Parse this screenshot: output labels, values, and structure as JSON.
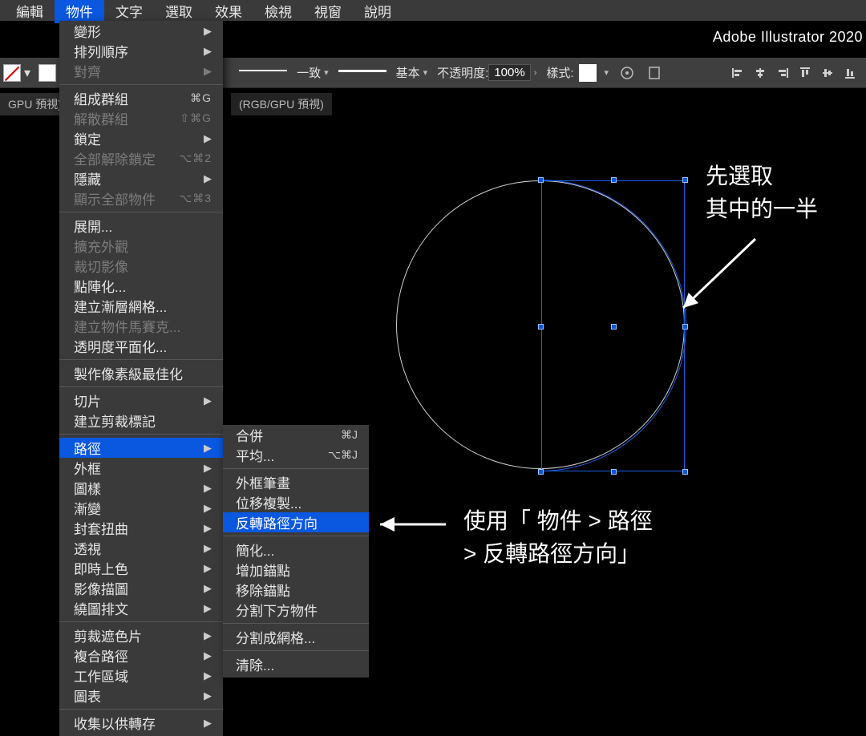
{
  "app_title": "Adobe Illustrator 2020",
  "menubar": [
    "編輯",
    "物件",
    "文字",
    "選取",
    "效果",
    "檢視",
    "視窗",
    "說明"
  ],
  "menubar_active_index": 1,
  "doc_tabs": {
    "left": "GPU 預視)",
    "other": "(RGB/GPU 預視)"
  },
  "ctrlbar": {
    "stroke_mode": "一致",
    "brush_label": "基本",
    "opacity_label": "不透明度:",
    "opacity_value": "100%",
    "style_label": "樣式:"
  },
  "menu": [
    {
      "label": "變形",
      "arrow": true
    },
    {
      "label": "排列順序",
      "arrow": true
    },
    {
      "label": "對齊",
      "arrow": true,
      "dim": true
    },
    {
      "sep": true
    },
    {
      "label": "組成群組",
      "sc": "⌘G"
    },
    {
      "label": "解散群組",
      "sc": "⇧⌘G",
      "dim": true
    },
    {
      "label": "鎖定",
      "arrow": true
    },
    {
      "label": "全部解除鎖定",
      "sc": "⌥⌘2",
      "dim": true
    },
    {
      "label": "隱藏",
      "arrow": true
    },
    {
      "label": "顯示全部物件",
      "sc": "⌥⌘3",
      "dim": true
    },
    {
      "sep": true
    },
    {
      "label": "展開..."
    },
    {
      "label": "擴充外觀",
      "dim": true
    },
    {
      "label": "裁切影像",
      "dim": true
    },
    {
      "label": "點陣化..."
    },
    {
      "label": "建立漸層網格..."
    },
    {
      "label": "建立物件馬賽克...",
      "dim": true
    },
    {
      "label": "透明度平面化..."
    },
    {
      "sep": true
    },
    {
      "label": "製作像素級最佳化"
    },
    {
      "sep": true
    },
    {
      "label": "切片",
      "arrow": true
    },
    {
      "label": "建立剪裁標記"
    },
    {
      "sep": true
    },
    {
      "label": "路徑",
      "arrow": true,
      "sel": true
    },
    {
      "label": "外框",
      "arrow": true
    },
    {
      "label": "圖樣",
      "arrow": true
    },
    {
      "label": "漸變",
      "arrow": true
    },
    {
      "label": "封套扭曲",
      "arrow": true
    },
    {
      "label": "透視",
      "arrow": true
    },
    {
      "label": "即時上色",
      "arrow": true
    },
    {
      "label": "影像描圖",
      "arrow": true
    },
    {
      "label": "繞圖排文",
      "arrow": true
    },
    {
      "sep": true
    },
    {
      "label": "剪裁遮色片",
      "arrow": true
    },
    {
      "label": "複合路徑",
      "arrow": true
    },
    {
      "label": "工作區域",
      "arrow": true
    },
    {
      "label": "圖表",
      "arrow": true
    },
    {
      "sep": true
    },
    {
      "label": "收集以供轉存",
      "arrow": true
    }
  ],
  "submenu": [
    {
      "label": "合併",
      "sc": "⌘J"
    },
    {
      "label": "平均...",
      "sc": "⌥⌘J"
    },
    {
      "sep": true
    },
    {
      "label": "外框筆畫"
    },
    {
      "label": "位移複製..."
    },
    {
      "label": "反轉路徑方向",
      "sel": true
    },
    {
      "sep": true
    },
    {
      "label": "簡化..."
    },
    {
      "label": "增加錨點"
    },
    {
      "label": "移除錨點"
    },
    {
      "label": "分割下方物件"
    },
    {
      "sep": true
    },
    {
      "label": "分割成網格..."
    },
    {
      "sep": true
    },
    {
      "label": "清除..."
    }
  ],
  "annotations": {
    "pick_half_l1": "先選取",
    "pick_half_l2": "其中的一半",
    "instr_l1": "使用「 物件 > 路徑",
    "instr_l2": " > 反轉路徑方向」"
  }
}
